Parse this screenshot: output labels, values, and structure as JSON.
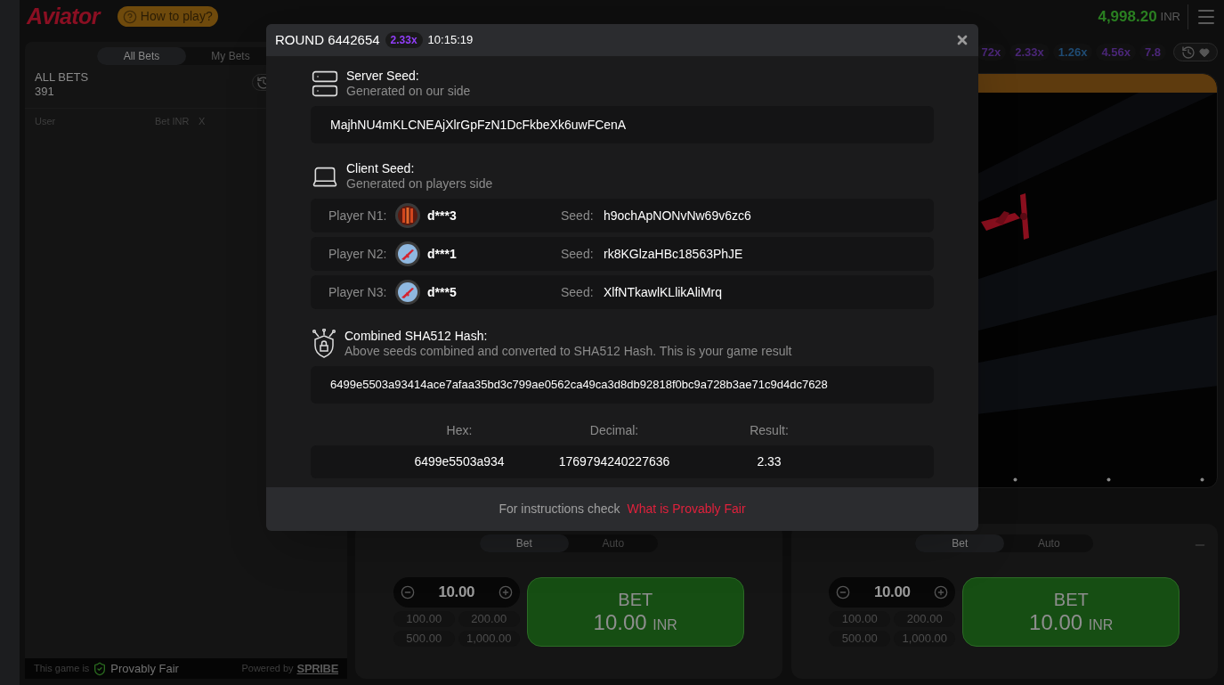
{
  "header": {
    "logo": "Aviator",
    "help_button": "How to play?",
    "balance": "4,998.20",
    "currency": "INR"
  },
  "bets_panel": {
    "tabs": [
      {
        "label": "All Bets",
        "selected": true
      },
      {
        "label": "My Bets",
        "selected": false
      }
    ],
    "title": "ALL BETS",
    "count": "391",
    "columns": [
      "User",
      "Bet INR",
      "X"
    ],
    "footer": {
      "prefix": "This game is",
      "badge": "Provably Fair",
      "powered_by": "Powered by",
      "brand": "SPRIBE"
    }
  },
  "multipliers": [
    {
      "value": "72x",
      "color": "#4a2677"
    },
    {
      "value": "2.33x",
      "color": "#4a2677"
    },
    {
      "value": "1.26x",
      "color": "#1f4b73"
    },
    {
      "value": "4.56x",
      "color": "#4a2677"
    },
    {
      "value": "7.8",
      "color": "#4a2677"
    }
  ],
  "bet_panels": [
    {
      "tabs": [
        {
          "label": "Bet",
          "selected": true
        },
        {
          "label": "Auto",
          "selected": false
        }
      ],
      "amount": "10.00",
      "quick_amounts": [
        "100.00",
        "200.00",
        "500.00",
        "1,000.00"
      ],
      "button": {
        "label": "BET",
        "amount": "10.00",
        "currency": "INR"
      },
      "removable": false
    },
    {
      "tabs": [
        {
          "label": "Bet",
          "selected": true
        },
        {
          "label": "Auto",
          "selected": false
        }
      ],
      "amount": "10.00",
      "quick_amounts": [
        "100.00",
        "200.00",
        "500.00",
        "1,000.00"
      ],
      "button": {
        "label": "BET",
        "amount": "10.00",
        "currency": "INR"
      },
      "removable": true
    }
  ],
  "modal": {
    "title": "ROUND 6442654",
    "multiplier": "2.33x",
    "time": "10:15:19",
    "server_seed": {
      "title": "Server Seed:",
      "subtitle": "Generated on our side",
      "value": "MajhNU4mKLCNEAjXlrGpFzN1DcFkbeXk6uwFCenA"
    },
    "client_seed": {
      "title": "Client Seed:",
      "subtitle": "Generated on players side",
      "players": [
        {
          "label": "Player N1:",
          "kind": "stripes",
          "name": "d***3",
          "seed_label": "Seed:",
          "seed": "h9ochApNONvNw69v6zc6"
        },
        {
          "label": "Player N2:",
          "kind": "plane",
          "name": "d***1",
          "seed_label": "Seed:",
          "seed": "rk8KGlzaHBc18563PhJE"
        },
        {
          "label": "Player N3:",
          "kind": "plane",
          "name": "d***5",
          "seed_label": "Seed:",
          "seed": "XlfNTkawlKLlikAliMrq"
        }
      ]
    },
    "hash": {
      "title": "Combined SHA512 Hash:",
      "subtitle": "Above seeds combined and converted to SHA512 Hash. This is your game result",
      "value": "6499e5503a93414ace7afaa35bd3c799ae0562ca49ca3d8db92818f0bc9a728b3ae71c9d4dc7628"
    },
    "result": [
      {
        "label": "Hex:",
        "value": "6499e5503a934"
      },
      {
        "label": "Decimal:",
        "value": "1769794240227636"
      },
      {
        "label": "Result:",
        "value": "2.33"
      }
    ],
    "footer": {
      "text": "For instructions check",
      "link": "What is Provably Fair"
    }
  }
}
